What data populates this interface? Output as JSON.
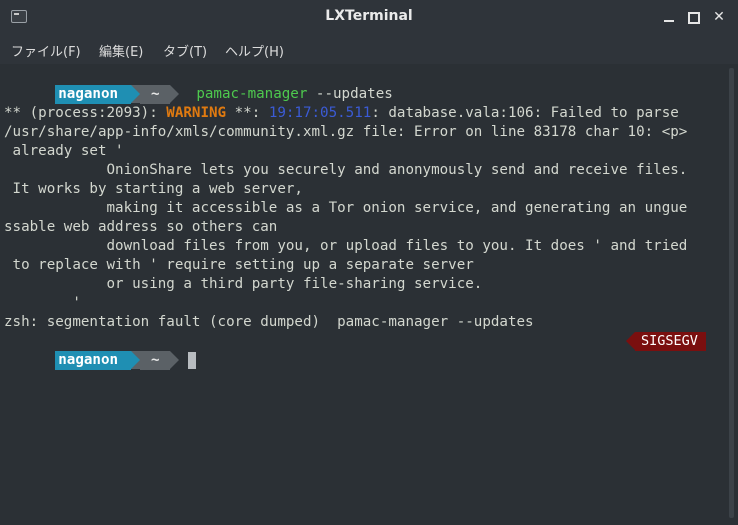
{
  "window": {
    "title": "LXTerminal",
    "minimize_symbol": "minimize",
    "maximize_symbol": "maximize",
    "close_symbol": "✕"
  },
  "menu": {
    "items": [
      "ファイル(F)",
      "編集(E)",
      "タブ(T)",
      "ヘルプ(H)"
    ]
  },
  "prompt": {
    "user": "naganon",
    "dir": "~"
  },
  "terminal": {
    "command_name": "pamac-manager",
    "command_args": " --updates",
    "lines": [
      "** (process:2093): ",
      "WARNING",
      " **: ",
      "19:17:05.511",
      ": database.vala:106: Failed to parse",
      "/usr/share/app-info/xmls/community.xml.gz file: Error on line 83178 char 10: <p>",
      " already set '",
      "            OnionShare lets you securely and anonymously send and receive files.",
      " It works by starting a web server,",
      "            making it accessible as a Tor onion service, and generating an ungue",
      "ssable web address so others can",
      "            download files from you, or upload files to you. It does ' and tried",
      " to replace with ' require setting up a separate server",
      "            or using a third party file-sharing service.",
      "        '",
      "zsh: segmentation fault (core dumped)  pamac-manager --updates"
    ],
    "signal_badge": "SIGSEGV"
  },
  "colors": {
    "background": "#2b3035",
    "prompt_user_bg": "#1f8fb3",
    "prompt_dir_bg": "#5b6166",
    "command": "#4ec94e",
    "warning": "#e07a10",
    "timestamp": "#3b5bd6",
    "signal_bg": "#7a0f0f"
  }
}
